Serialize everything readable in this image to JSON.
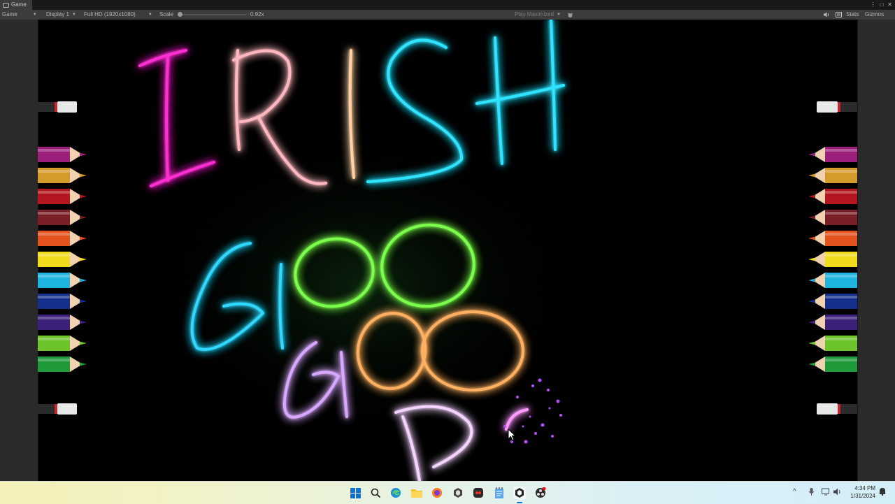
{
  "window": {
    "tab_title": "Game"
  },
  "toolbar": {
    "view_mode": "Game",
    "display": "Display 1",
    "resolution": "Full HD (1920x1080)",
    "scale_label": "Scale",
    "scale_value": "0.92x",
    "play_mode": "Play Maximized",
    "stats_label": "Stats",
    "gizmos_label": "Gizmos"
  },
  "canvas": {
    "words": [
      "IRISH",
      "GOO",
      "GOO",
      "D"
    ],
    "pencil_colors": [
      "#9c1f7c",
      "#d49a2a",
      "#b4161f",
      "#7a1f28",
      "#e2531e",
      "#f0dc1c",
      "#1fb3e0",
      "#15308c",
      "#3d207a",
      "#6cc42a",
      "#1e9a3a"
    ],
    "eraser_color": "#e6e6e6"
  },
  "taskbar": {
    "apps": [
      "start",
      "search",
      "edge",
      "file-explorer",
      "firefox",
      "unity-hub",
      "app",
      "notepad",
      "unity",
      "obs"
    ],
    "time": "4:34 PM",
    "date": "1/31/2024"
  }
}
